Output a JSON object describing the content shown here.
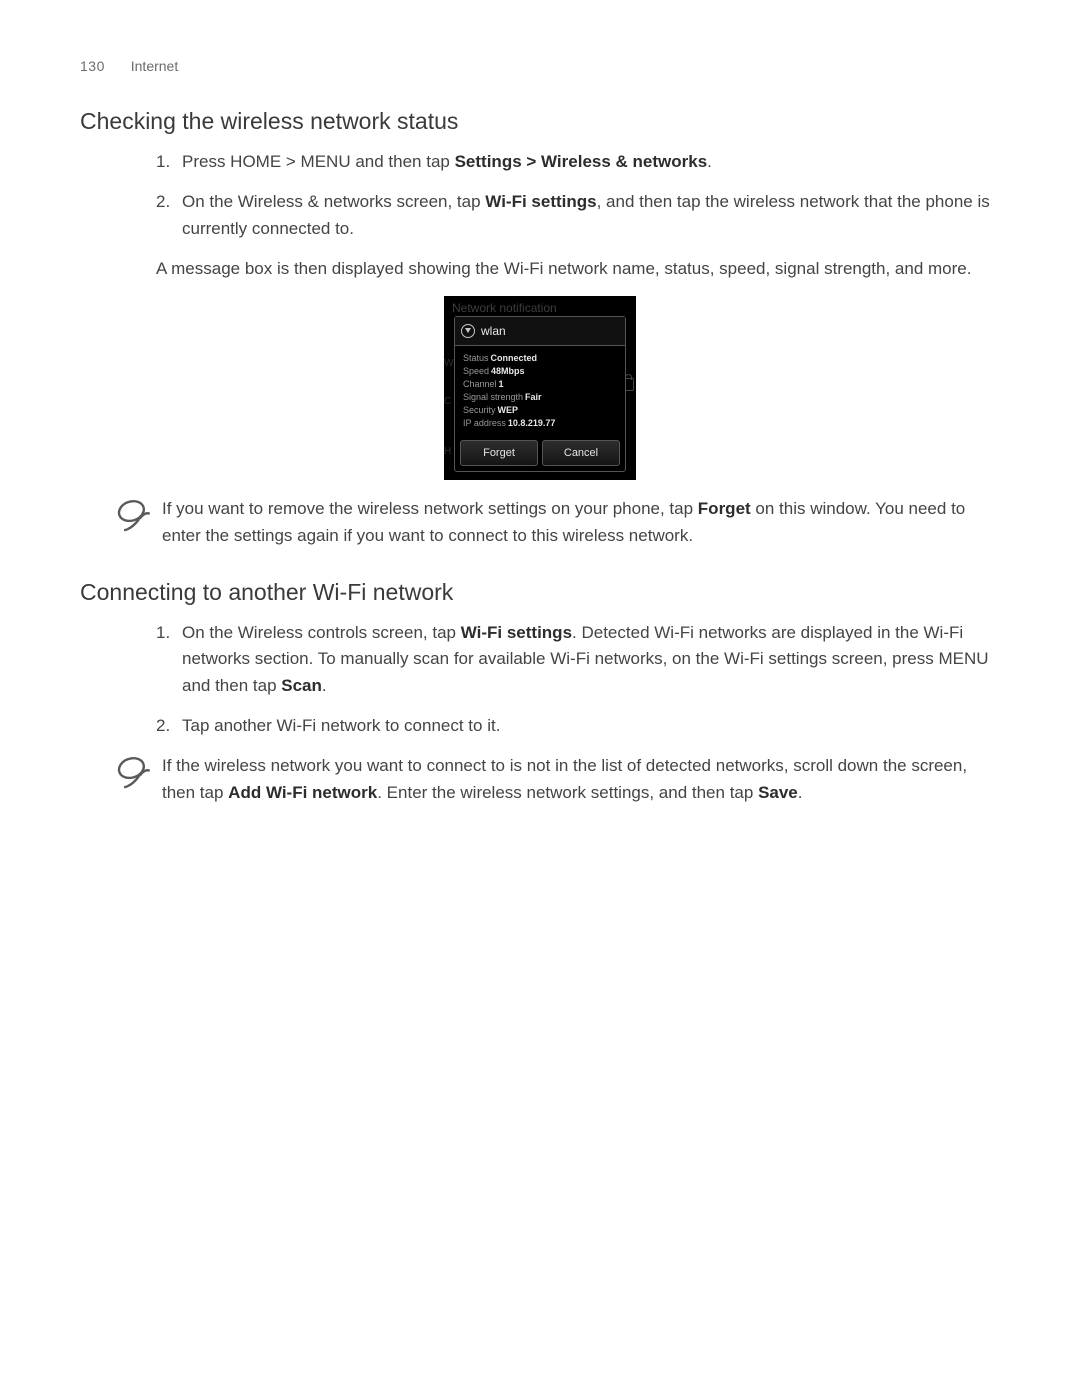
{
  "header": {
    "page_number": "130",
    "section": "Internet"
  },
  "s1": {
    "title": "Checking the wireless network status",
    "step1_pre": "Press HOME > MENU and then tap ",
    "step1_bold": "Settings > Wireless & networks",
    "step1_post": ".",
    "step2_pre": "On the Wireless & networks screen, tap ",
    "step2_bold": "Wi-Fi settings",
    "step2_post": ", and then tap the wireless network that the phone is currently connected to.",
    "after": "A message box is then displayed showing the Wi-Fi network name, status, speed, signal strength, and more.",
    "tip_pre": "If you want to remove the wireless network settings on your phone, tap ",
    "tip_bold": "Forget",
    "tip_post": " on this window. You need to enter the settings again if you want to connect to this wireless network."
  },
  "shot": {
    "bg_label": "Network notification",
    "bg_left1": "W",
    "bg_left2": "C",
    "bg_left3": "H",
    "title": "wlan",
    "status_l": "Status",
    "status_v": "Connected",
    "speed_l": "Speed",
    "speed_v": "48Mbps",
    "channel_l": "Channel",
    "channel_v": "1",
    "signal_l": "Signal strength",
    "signal_v": "Fair",
    "security_l": "Security",
    "security_v": "WEP",
    "ip_l": "IP address",
    "ip_v": "10.8.219.77",
    "btn_forget": "Forget",
    "btn_cancel": "Cancel"
  },
  "s2": {
    "title": "Connecting to another Wi-Fi network",
    "step1_pre": "On the Wireless controls screen, tap ",
    "step1_bold1": "Wi-Fi settings",
    "step1_mid": ". Detected Wi-Fi networks are displayed in the Wi-Fi networks section. To manually scan for available Wi-Fi networks, on the Wi-Fi settings screen, press MENU and then tap ",
    "step1_bold2": "Scan",
    "step1_post": ".",
    "step2": "Tap another Wi-Fi network to connect to it.",
    "tip_pre": "If the wireless network you want to connect to is not in the list of detected networks, scroll down the screen, then tap ",
    "tip_bold1": "Add Wi-Fi network",
    "tip_mid": ". Enter the wireless network settings, and then tap ",
    "tip_bold2": "Save",
    "tip_post": "."
  }
}
